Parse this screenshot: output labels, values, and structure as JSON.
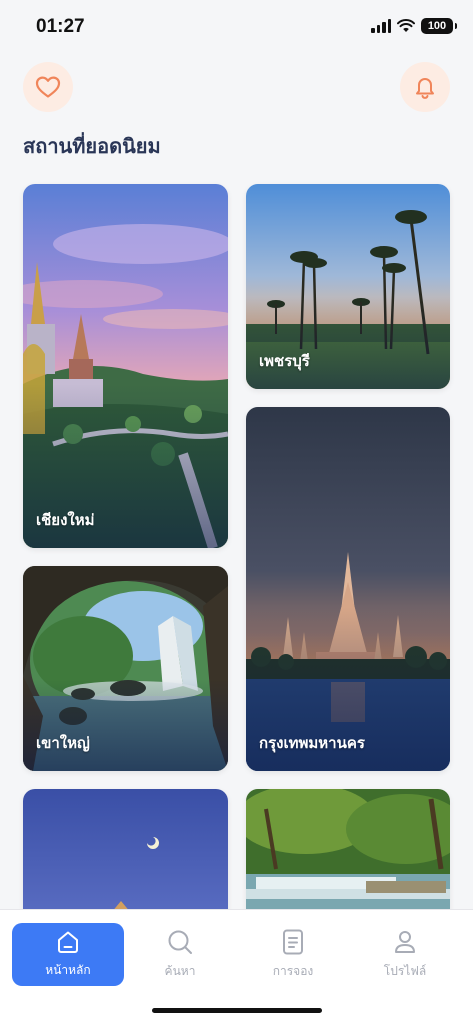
{
  "status_bar": {
    "time": "01:27",
    "battery": "100"
  },
  "header": {
    "favorites_icon": "heart-icon",
    "notifications_icon": "bell-icon",
    "accent": "#f0855a",
    "accent_bg": "#fdece3"
  },
  "section": {
    "title": "สถานที่ยอดนิยม"
  },
  "places": [
    {
      "name": "เชียงใหม่"
    },
    {
      "name": "เพชรบุรี"
    },
    {
      "name": "เขาใหญ่"
    },
    {
      "name": "กรุงเทพมหานคร"
    },
    {
      "name": ""
    },
    {
      "name": ""
    }
  ],
  "tabs": [
    {
      "label": "หน้าหลัก",
      "icon": "home-icon",
      "active": true
    },
    {
      "label": "ค้นหา",
      "icon": "search-icon",
      "active": false
    },
    {
      "label": "การจอง",
      "icon": "booking-icon",
      "active": false
    },
    {
      "label": "โปรไฟล์",
      "icon": "profile-icon",
      "active": false
    }
  ],
  "colors": {
    "active_tab": "#3d7af5",
    "title_text": "#2a3657",
    "inactive_tab_text": "#a8acb6"
  }
}
